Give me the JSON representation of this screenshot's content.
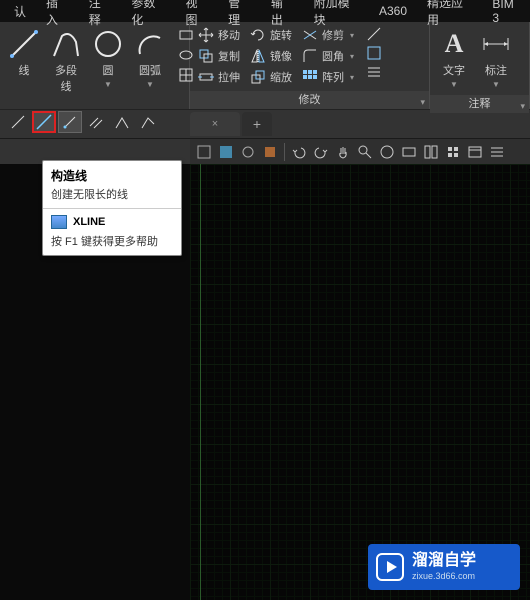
{
  "menubar": {
    "tabs": [
      "认",
      "插入",
      "注释",
      "参数化",
      "视图",
      "管理",
      "输出",
      "附加模块",
      "A360",
      "精选应用",
      "BIM 3"
    ]
  },
  "ribbon": {
    "draw": {
      "tools": {
        "line": "线",
        "pline": "多段线",
        "circle": "圆",
        "arc": "圆弧"
      }
    },
    "modify": {
      "title": "修改",
      "rows": [
        {
          "a": "移动",
          "b": "旋转",
          "c": "修剪"
        },
        {
          "a": "复制",
          "b": "镜像",
          "c": "圆角"
        },
        {
          "a": "拉伸",
          "b": "缩放",
          "c": "阵列"
        }
      ]
    },
    "annot": {
      "title": "注释",
      "text": "文字",
      "dim": "标注"
    }
  },
  "tooltip": {
    "title": "构造线",
    "desc": "创建无限长的线",
    "cmd": "XLINE",
    "help": "按 F1 键获得更多帮助"
  },
  "watermark": {
    "name": "溜溜自学",
    "url": "zixue.3d66.com"
  }
}
